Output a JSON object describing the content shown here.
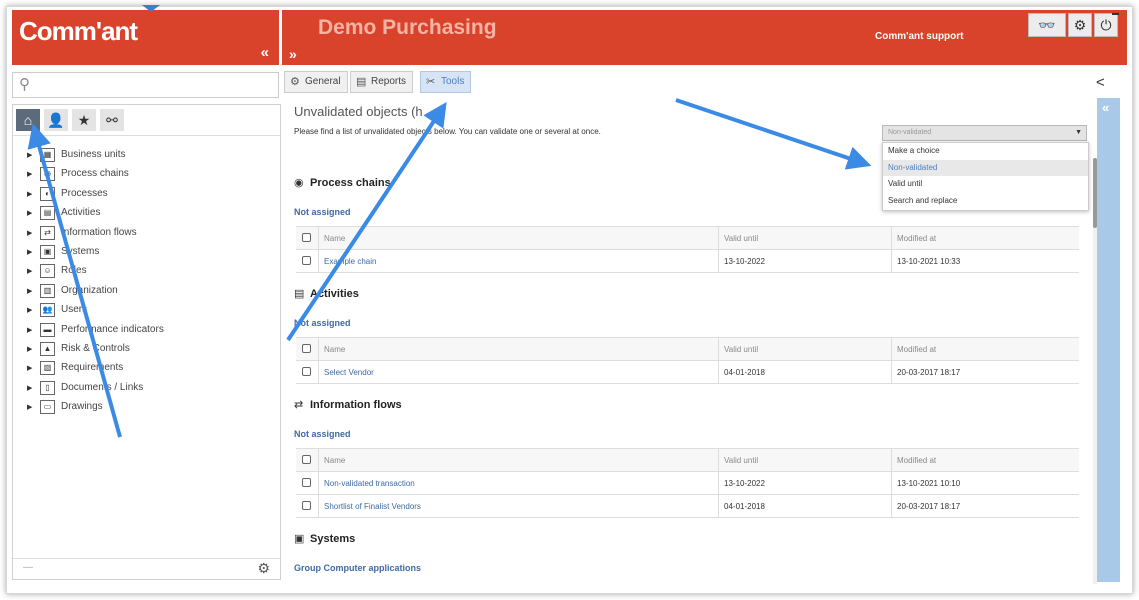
{
  "left": {
    "logo": "Comm'ant",
    "collapse_glyph": "«",
    "search_icon": "search-icon",
    "tabs": [
      {
        "name": "home",
        "glyph": "⌂"
      },
      {
        "name": "user",
        "glyph": "👤"
      },
      {
        "name": "favorites",
        "glyph": "★"
      },
      {
        "name": "links",
        "glyph": "⚯"
      }
    ],
    "tree": [
      {
        "label": "Business units",
        "glyph": "▦"
      },
      {
        "label": "Process chains",
        "glyph": "◉"
      },
      {
        "label": "Processes",
        "glyph": "◐"
      },
      {
        "label": "Activities",
        "glyph": "▤"
      },
      {
        "label": "Information flows",
        "glyph": "⇄"
      },
      {
        "label": "Systems",
        "glyph": "▣"
      },
      {
        "label": "Roles",
        "glyph": "☺"
      },
      {
        "label": "Organization",
        "glyph": "▥"
      },
      {
        "label": "Users",
        "glyph": "👥"
      },
      {
        "label": "Performance indicators",
        "glyph": "▬"
      },
      {
        "label": "Risk & Controls",
        "glyph": "▲"
      },
      {
        "label": "Requirements",
        "glyph": "▧"
      },
      {
        "label": "Documents / Links",
        "glyph": "▯"
      },
      {
        "label": "Drawings",
        "glyph": "▭"
      }
    ],
    "footer_dash": "—",
    "footer_gear": "⚙"
  },
  "header": {
    "title": "Demo Purchasing",
    "expand_glyph": "»",
    "support": "Comm'ant support",
    "glasses_glyph": "👓",
    "gear_glyph": "⚙",
    "logout_glyph": "⏻"
  },
  "tabs": [
    {
      "label": "General",
      "glyph": "⚙"
    },
    {
      "label": "Reports",
      "glyph": "▤"
    },
    {
      "label": "Tools",
      "glyph": "✂"
    }
  ],
  "share_glyph": "<",
  "content": {
    "title": "Unvalidated objects (h",
    "description": "Please find a list of unvalidated objects below. You can validate one or several at once.",
    "columns": [
      "Name",
      "Valid until",
      "Modified at"
    ],
    "sections": [
      {
        "title": "Process chains",
        "glyph": "◉",
        "group": "Not assigned",
        "rows": [
          {
            "name": "Example chain",
            "valid": "13-10-2022",
            "modified": "13-10-2021 10:33"
          }
        ]
      },
      {
        "title": "Activities",
        "glyph": "▤",
        "group": "Not assigned",
        "rows": [
          {
            "name": "Select Vendor",
            "valid": "04-01-2018",
            "modified": "20-03-2017 18:17"
          }
        ]
      },
      {
        "title": "Information flows",
        "glyph": "⇄",
        "group": "Not assigned",
        "rows": [
          {
            "name": "Non-validated transaction",
            "valid": "13-10-2022",
            "modified": "13-10-2021 10:10"
          },
          {
            "name": "Shortlist of Finalist Vendors",
            "valid": "04-01-2018",
            "modified": "20-03-2017 18:17"
          }
        ]
      },
      {
        "title": "Systems",
        "glyph": "▣",
        "group": "Group Computer applications",
        "rows": []
      }
    ]
  },
  "dropdown": {
    "selected": "Non-validated",
    "options": [
      "Make a choice",
      "Non-validated",
      "Valid until",
      "Search and replace"
    ],
    "highlighted_index": 1
  },
  "colors": {
    "brand_red": "#d9432c",
    "link_blue": "#3f6aa3",
    "annotation_arrow": "#3b8ae6",
    "side_blue": "#a9c9e8"
  }
}
